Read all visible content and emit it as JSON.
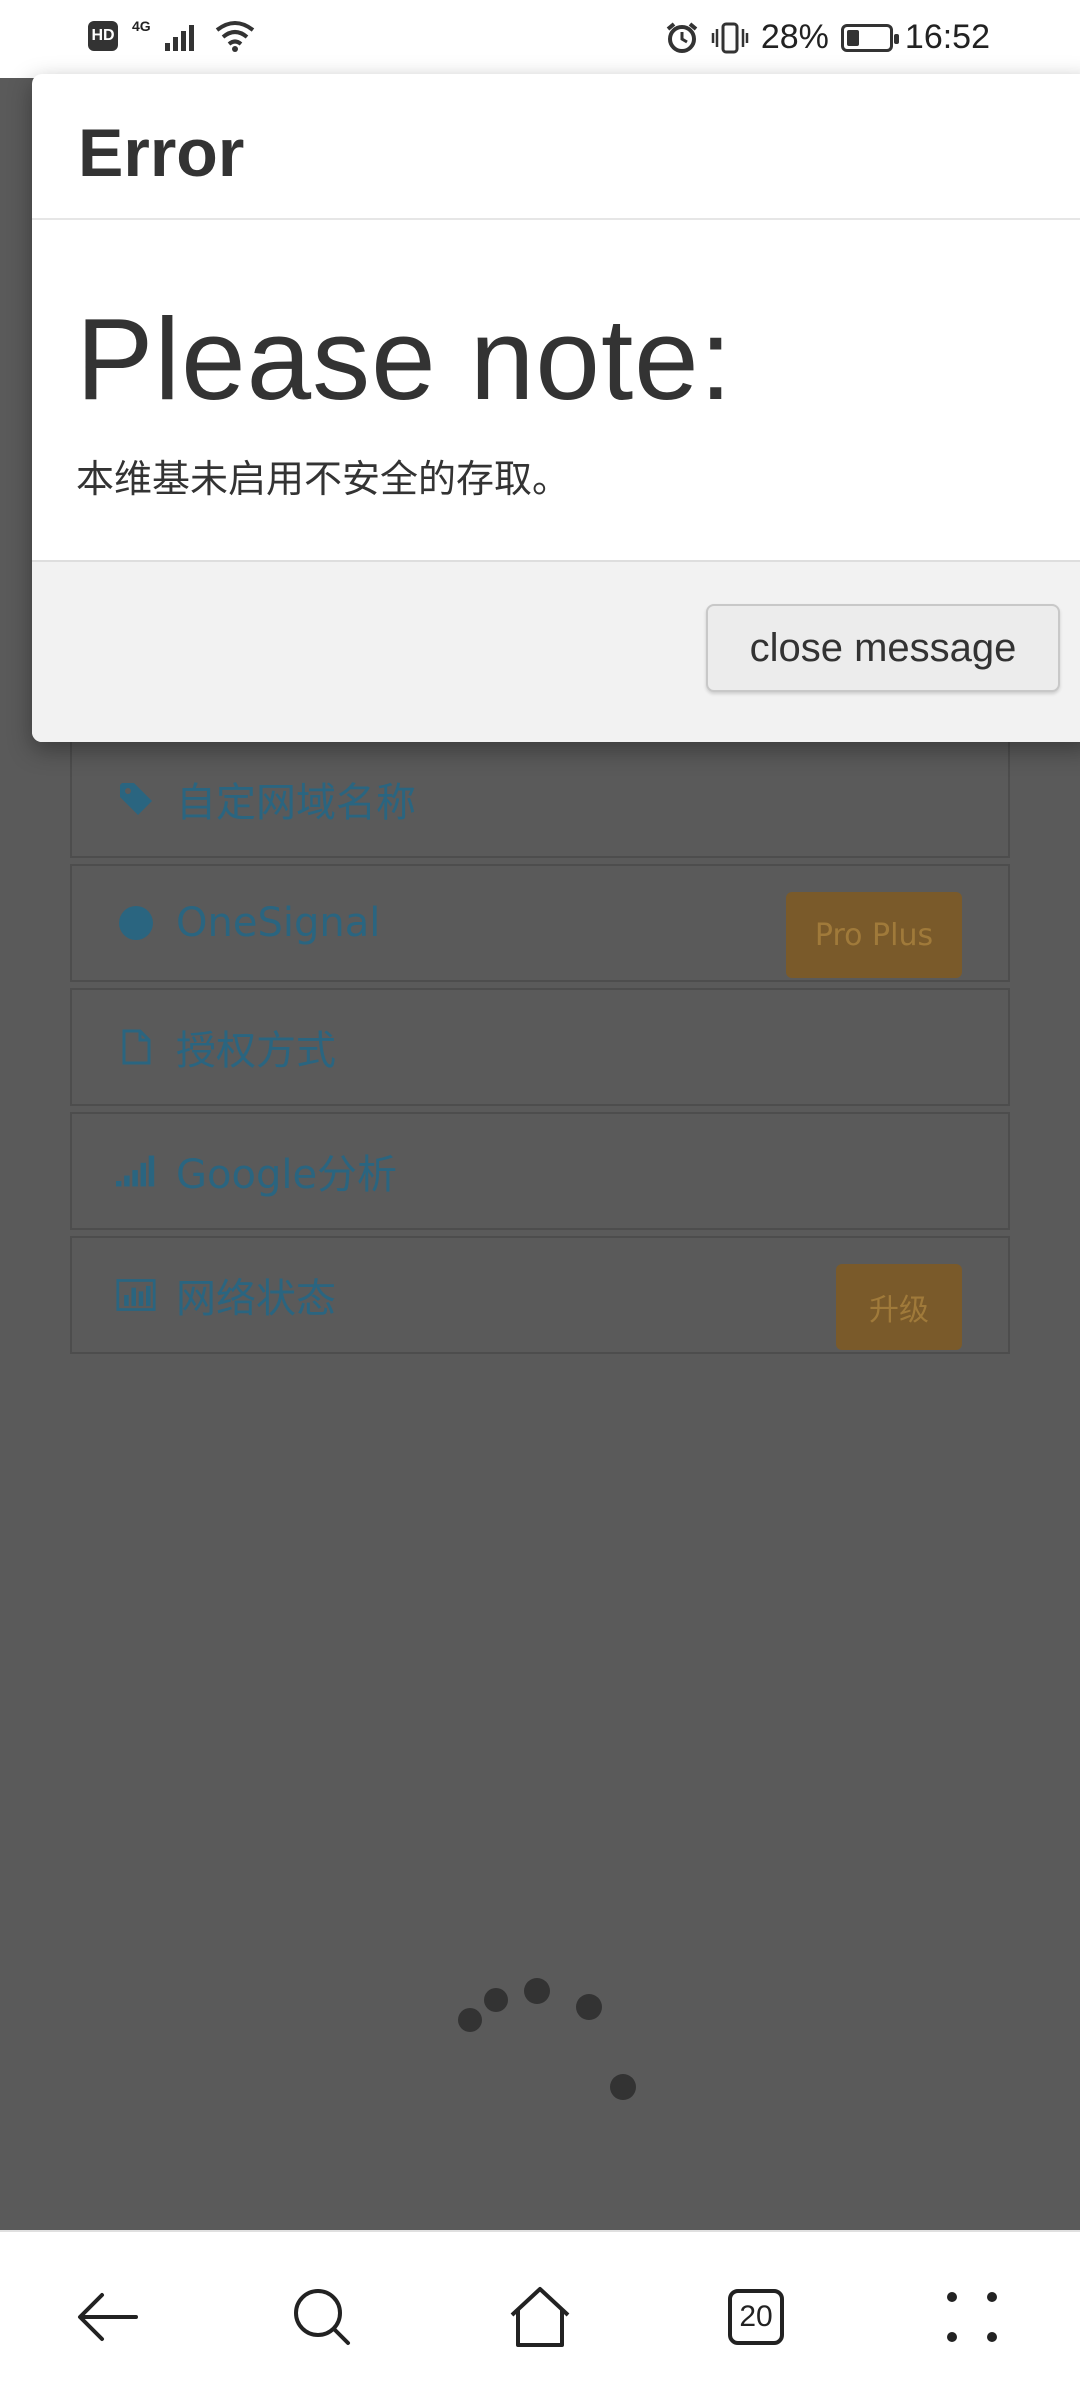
{
  "status_bar": {
    "hd_label": "HD",
    "network_label": "4G",
    "battery_percent": "28%",
    "time": "16:52"
  },
  "background_list": {
    "items": [
      {
        "label": "自定网域名称",
        "icon": "tag-icon"
      },
      {
        "label": "OneSignal",
        "icon": "circle-icon",
        "badge": "Pro Plus"
      },
      {
        "label": "授权方式",
        "icon": "document-icon"
      },
      {
        "label": "Google分析",
        "icon": "signal-bars-icon"
      },
      {
        "label": "网络状态",
        "icon": "bar-chart-icon",
        "badge": "升级"
      }
    ]
  },
  "modal": {
    "title": "Error",
    "heading": "Please note:",
    "message": "本维基未启用不安全的存取。",
    "close_label": "close message"
  },
  "bottom_nav": {
    "tab_count": "20"
  },
  "colors": {
    "overlay": "#555555",
    "link_text": "#2a6580",
    "badge": "#7a5a2a",
    "modal_footer": "#f2f2f2"
  }
}
